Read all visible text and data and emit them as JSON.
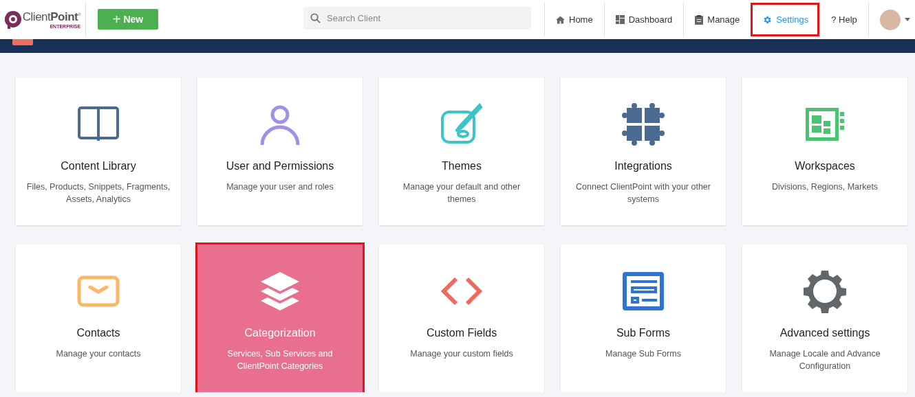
{
  "header": {
    "logo": {
      "brand": "Client**Point**",
      "mark": "®",
      "tagline": "ENTERPRISE"
    },
    "new_button": {
      "sign": "+",
      "label": "New"
    },
    "search": {
      "placeholder": "Search Client"
    },
    "nav": [
      {
        "label": "Home",
        "kind": "home",
        "selected": false,
        "highlighted": false
      },
      {
        "label": "Dashboard",
        "kind": "dashboard",
        "selected": false,
        "highlighted": false
      },
      {
        "label": "Manage",
        "kind": "clipboard",
        "selected": false,
        "highlighted": false
      },
      {
        "label": "Settings",
        "kind": "gear",
        "selected": true,
        "highlighted": true
      },
      {
        "label": "? Help",
        "kind": "plain",
        "selected": false,
        "highlighted": false
      }
    ]
  },
  "cards": [
    {
      "title": "Content Library",
      "description": "Files, Products, Snippets, Fragments, Assets, Analytics",
      "kind": "book",
      "color": "#4a6a8f",
      "selected": false,
      "highlighted": false
    },
    {
      "title": "User and Permissions",
      "description": "Manage your user and roles",
      "kind": "user",
      "color": "#a48fe6",
      "selected": false,
      "highlighted": false
    },
    {
      "title": "Themes",
      "description": "Manage your default and other themes",
      "kind": "palette",
      "color": "#3cc4c8",
      "selected": false,
      "highlighted": false
    },
    {
      "title": "Integrations",
      "description": "Connect ClientPoint with your other systems",
      "kind": "puzzle",
      "color": "#4a6a8f",
      "selected": false,
      "highlighted": false
    },
    {
      "title": "Workspaces",
      "description": "Divisions, Regions, Markets",
      "kind": "workspace",
      "color": "#4cc373",
      "selected": false,
      "highlighted": false
    },
    {
      "title": "Contacts",
      "description": "Manage your contacts",
      "kind": "envelope",
      "color": "#fdb863",
      "selected": false,
      "highlighted": false
    },
    {
      "title": "Categorization",
      "description": "Services, Sub Services and ClientPoint Categories",
      "kind": "layers",
      "color": "#ffffff",
      "selected": true,
      "highlighted": true
    },
    {
      "title": "Custom Fields",
      "description": "Manage your custom fields",
      "kind": "code",
      "color": "#ee6a5f",
      "selected": false,
      "highlighted": false
    },
    {
      "title": "Sub Forms",
      "description": "Manage Sub Forms",
      "kind": "form",
      "color": "#2f74d0",
      "selected": false,
      "highlighted": false
    },
    {
      "title": "Advanced settings",
      "description": "Manage Locale and Advance Configuration",
      "kind": "gear",
      "color": "#62676b",
      "selected": false,
      "highlighted": false
    }
  ]
}
